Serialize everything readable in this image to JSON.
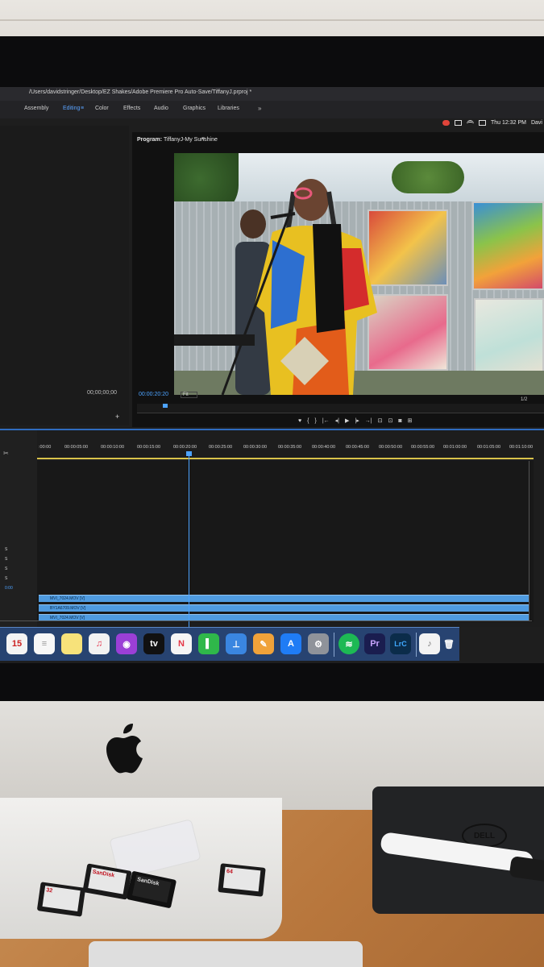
{
  "window": {
    "title_path": "/Users/davidstringer/Desktop/EZ Shakes/Adobe Premiere Pro Auto-Save/TiffanyJ.prproj *"
  },
  "workspaces": [
    {
      "label": "Assembly",
      "active": false
    },
    {
      "label": "Editing",
      "active": true
    },
    {
      "label": "Color",
      "active": false
    },
    {
      "label": "Effects",
      "active": false
    },
    {
      "label": "Audio",
      "active": false
    },
    {
      "label": "Graphics",
      "active": false
    },
    {
      "label": "Libraries",
      "active": false
    }
  ],
  "workspace_more": "»",
  "workspace_menu_glyph": "≡",
  "system_status": {
    "clock": "Thu 12:32 PM",
    "user": "Davi"
  },
  "source_monitor": {
    "timecode": "00;00;00;00",
    "add_button": "+"
  },
  "program_monitor": {
    "label": "Program:",
    "sequence": "TiffanyJ-My Sunshine",
    "menu_glyph": "≡",
    "timecode": "00:00:20:20",
    "zoom": "Fit",
    "resolution": "1/2"
  },
  "transport": [
    "♥",
    "{",
    "}",
    "|←",
    "◂|",
    "▶",
    "|▸",
    "→|",
    "⊡",
    "⊡",
    "◙",
    "⊞"
  ],
  "timeline": {
    "ruler": [
      ":00:00",
      "00:00:05:00",
      "00:00:10:00",
      "00:00:15:00",
      "00:00:20:00",
      "00:00:25:00",
      "00:00:30:00",
      "00:00:35:00",
      "00:00:40:00",
      "00:00:45:00",
      "00:00:50:00",
      "00:00:55:00",
      "00:01:00:00",
      "00:01:05:00",
      "00:01:10:00"
    ],
    "video_clips": [
      "MVI_7024.MOV [V]",
      "BY1A6709.MOV [V]",
      "MVI_7024.MOV [V]"
    ],
    "track_solo": [
      "S",
      "S",
      "S",
      "S"
    ],
    "timecode": "0:00"
  },
  "dock": {
    "apps": [
      {
        "name": "calendar",
        "label": "15",
        "color": "#f4f4f4"
      },
      {
        "name": "reminders",
        "label": "≡",
        "color": "#f7f7f7"
      },
      {
        "name": "notes",
        "label": "",
        "color": "#f7e27a"
      },
      {
        "name": "music",
        "label": "♫",
        "color": "#f2f2f2"
      },
      {
        "name": "podcasts",
        "label": "◉",
        "color": "#9b3fd6"
      },
      {
        "name": "tv",
        "label": "tv",
        "color": "#111111"
      },
      {
        "name": "news",
        "label": "N",
        "color": "#f5f5f5"
      },
      {
        "name": "numbers",
        "label": "▌",
        "color": "#2fb84a"
      },
      {
        "name": "keynote",
        "label": "⊥",
        "color": "#3a86e0"
      },
      {
        "name": "pages",
        "label": "✎",
        "color": "#f0a23a"
      },
      {
        "name": "app-store",
        "label": "A",
        "color": "#1f7cf5"
      },
      {
        "name": "system-preferences",
        "label": "⚙",
        "color": "#8f939a"
      },
      {
        "name": "spotify",
        "label": "≋",
        "color": "#1db954"
      },
      {
        "name": "premiere-pro",
        "label": "Pr",
        "color": "#1a1d4f"
      },
      {
        "name": "lightroom-classic",
        "label": "LrC",
        "color": "#0b2c4a"
      },
      {
        "name": "music-file",
        "label": "♪",
        "color": "#f3f3f3"
      },
      {
        "name": "trash",
        "label": "🗑",
        "color": "#b9c4cf"
      }
    ]
  },
  "desk": {
    "sd_cards": [
      "32",
      "SanDisk",
      "SanDisk",
      "64"
    ],
    "laptop_brand": "DELL"
  }
}
